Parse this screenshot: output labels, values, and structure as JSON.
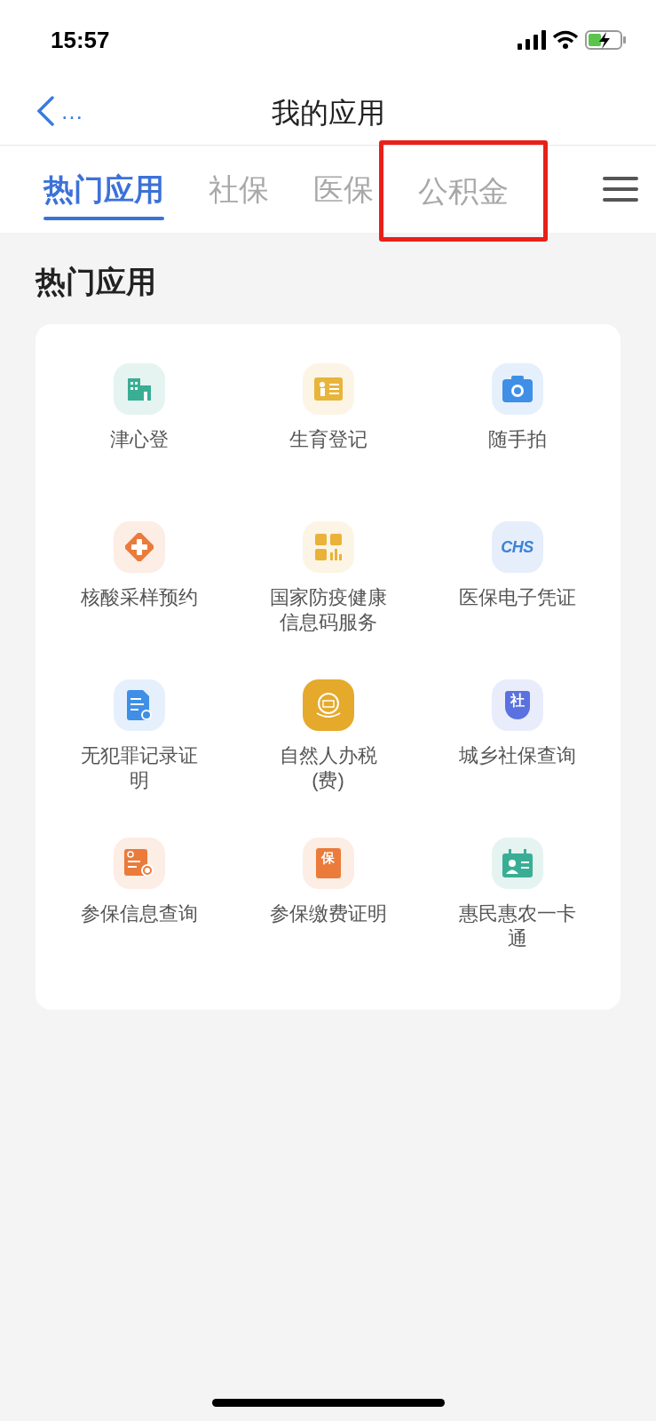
{
  "status_bar": {
    "time": "15:57"
  },
  "nav": {
    "back": "…",
    "title": "我的应用"
  },
  "tabs": [
    {
      "label": "热门应用",
      "selected": true,
      "highlighted": false
    },
    {
      "label": "社保",
      "selected": false,
      "highlighted": false
    },
    {
      "label": "医保",
      "selected": false,
      "highlighted": false
    },
    {
      "label": "公积金",
      "selected": false,
      "highlighted": true
    }
  ],
  "section": {
    "title": "热门应用"
  },
  "apps": [
    {
      "label": "津心登",
      "kind": "building",
      "color": "#3aae94"
    },
    {
      "label": "生育登记",
      "kind": "card",
      "color": "#e8b53a"
    },
    {
      "label": "随手拍",
      "kind": "camera",
      "color": "#3f8fe6"
    },
    {
      "label": "核酸采样预约",
      "kind": "cross",
      "color": "#ea7b3a"
    },
    {
      "label": "国家防疫健康信息码服务",
      "kind": "grid",
      "color": "#eab23a"
    },
    {
      "label": "医保电子凭证",
      "kind": "text",
      "color": "#3c82d8",
      "glyph": "CHS"
    },
    {
      "label": "无犯罪记录证明",
      "kind": "doc",
      "color": "#3f8fe6"
    },
    {
      "label": "自然人办税(费)",
      "kind": "emblem",
      "color": "#e5a92c"
    },
    {
      "label": "城乡社保查询",
      "kind": "shield",
      "color": "#5a72e0",
      "glyph": "社"
    },
    {
      "label": "参保信息查询",
      "kind": "searchdoc",
      "color": "#ea7b3a"
    },
    {
      "label": "参保缴费证明",
      "kind": "bao",
      "color": "#ea7b3a",
      "glyph": "保"
    },
    {
      "label": "惠民惠农一卡通",
      "kind": "contact",
      "color": "#3aae94"
    }
  ]
}
